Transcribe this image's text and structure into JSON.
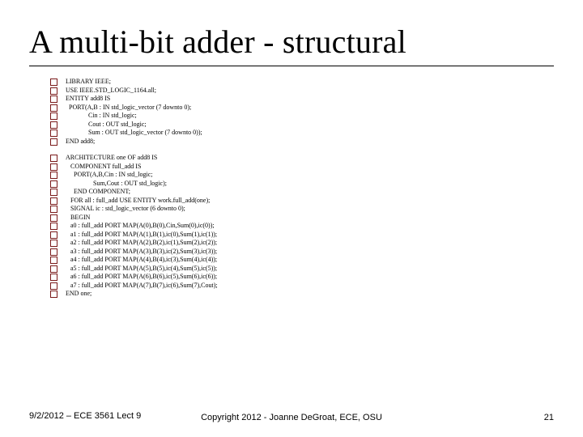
{
  "title": "A multi-bit adder - structural",
  "code_block_a": [
    "LIBRARY IEEE;",
    "USE IEEE.STD_LOGIC_1164.all;",
    "ENTITY add8 IS",
    "  PORT(A,B : IN std_logic_vector (7 downto 0);",
    "              Cin : IN std_logic;",
    "              Cout : OUT std_logic;",
    "              Sum : OUT std_logic_vector (7 downto 0));",
    "END add8;"
  ],
  "code_block_b": [
    "ARCHITECTURE one OF add8 IS",
    "   COMPONENT full_add IS",
    "     PORT(A,B,Cin : IN std_logic;",
    "                 Sum,Cout : OUT std_logic);",
    "     END COMPONENT;",
    "   FOR all : full_add USE ENTITY work.full_add(one);",
    "   SIGNAL ic : std_logic_vector (6 downto 0);",
    "   BEGIN",
    "   a0 : full_add PORT MAP(A(0),B(0),Cin,Sum(0),ic(0));",
    "   a1 : full_add PORT MAP(A(1),B(1),ic(0),Sum(1),ic(1));",
    "   a2 : full_add PORT MAP(A(2),B(2),ic(1),Sum(2),ic(2));",
    "   a3 : full_add PORT MAP(A(3),B(3),ic(2),Sum(3),ic(3));",
    "   a4 : full_add PORT MAP(A(4),B(4),ic(3),Sum(4),ic(4));",
    "   a5 : full_add PORT MAP(A(5),B(5),ic(4),Sum(5),ic(5));",
    "   a6 : full_add PORT MAP(A(6),B(6),ic(5),Sum(6),ic(6));",
    "   a7 : full_add PORT MAP(A(7),B(7),ic(6),Sum(7),Cout);",
    "END one;"
  ],
  "footer": {
    "left": "9/2/2012 – ECE 3561 Lect 9",
    "center": "Copyright 2012 - Joanne DeGroat, ECE, OSU",
    "right": "21"
  }
}
